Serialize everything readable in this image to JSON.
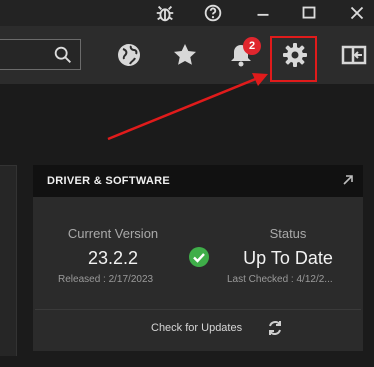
{
  "toolbar": {
    "search_placeholder": "",
    "notifications_badge": "2"
  },
  "card": {
    "title": "DRIVER & SOFTWARE",
    "current_version_label": "Current Version",
    "current_version_value": "23.2.2",
    "released_text": "Released : 2/17/2023",
    "status_label": "Status",
    "status_value": "Up To Date",
    "last_checked_text": "Last Checked : 4/12/2...",
    "check_updates_label": "Check for Updates"
  },
  "colors": {
    "accent_red": "#e01b1b",
    "badge_red": "#e0262e",
    "status_green": "#3fae49"
  },
  "icons": [
    "bug-icon",
    "help-icon",
    "minimize-icon",
    "maximize-icon",
    "close-icon",
    "search-icon",
    "globe-icon",
    "star-icon",
    "bell-icon",
    "gear-icon",
    "exit-icon",
    "expand-icon",
    "check-circle-icon",
    "refresh-icon"
  ]
}
